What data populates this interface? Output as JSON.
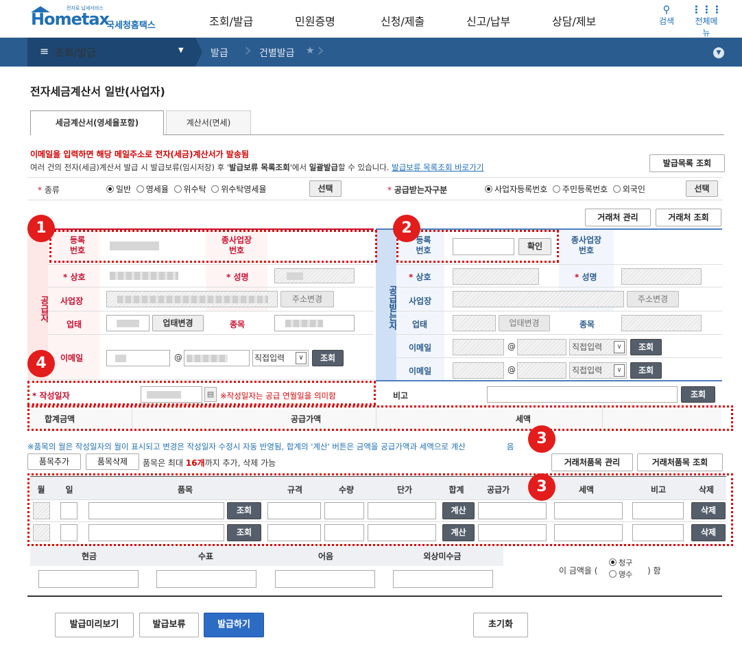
{
  "header": {
    "logo_small": "전자로 납세서비스",
    "logo_main": "Hometax",
    "logo_sub": "국세청홈택스",
    "menu": [
      "조회/발급",
      "민원증명",
      "신청/제출",
      "신고/납부",
      "상담/제보"
    ],
    "search_label": "검색",
    "allmenu_label": "전체메뉴"
  },
  "nav": {
    "home_label": "조회/발급",
    "crumbs": [
      "발급",
      "건별발급"
    ]
  },
  "page": {
    "title": "전자세금계산서 일반(사업자)",
    "tabs": [
      "세금계산서(영세율포함)",
      "계산서(면세)"
    ],
    "notice_red": "이메일을 입력하면 해당 메일주소로 전자(세금)계산서가 발송됨",
    "notice_a": "여러 건의 전자(세금)계산서 발급 시 발급보류(임시저장) 후 '",
    "notice_b": "발급보류 목록조회",
    "notice_c": "'에서 ",
    "notice_d": "일괄발급",
    "notice_e": "할 수 있습니다. ",
    "notice_link": "발급보류 목록조회 바로가기",
    "list_btn": "발급목록 조회"
  },
  "type_row": {
    "label": "종류",
    "options": [
      "일반",
      "영세율",
      "위수탁",
      "위수탁영세율"
    ],
    "select_btn": "선택",
    "recv_label": "공급받는자구분",
    "recv_options": [
      "사업자등록번호",
      "주민등록번호",
      "외국인"
    ],
    "recv_select_btn": "선택"
  },
  "partner_btns": [
    "거래처 관리",
    "거래처 조회"
  ],
  "supplier": {
    "band": "공급자",
    "reg_label": "등록\n번호",
    "sub_label": "종사업장\n번호",
    "name_label": "상호",
    "ceo_label": "성명",
    "addr_label": "사업장",
    "addr_btn": "주소변경",
    "biz_label": "업태",
    "biz_btn": "업태변경",
    "item_label": "종목",
    "email_label": "이메일",
    "email_at": "@",
    "email_select": "직접입력",
    "email_btn": "조회"
  },
  "receiver": {
    "band": "공급받는자",
    "reg_label": "등록\n번호",
    "confirm_btn": "확인",
    "sub_label": "종사업장\n번호",
    "name_label": "상호",
    "ceo_label": "성명",
    "addr_label": "사업장",
    "addr_btn": "주소변경",
    "biz_label": "업태",
    "biz_btn": "업태변경",
    "item_label": "종목",
    "email_label": "이메일",
    "email_at": "@",
    "email_select": "직접입력",
    "email_btn": "조회"
  },
  "date_row": {
    "label": "작성일자",
    "note": "※작성일자는 공급 연월일을 의미함",
    "remark_label": "비고",
    "remark_btn": "조회"
  },
  "totals": {
    "total_label": "합계금액",
    "supply_label": "공급가액",
    "tax_label": "세액"
  },
  "items": {
    "note": "※품목의 월은 작성일자의 월이 표시되고 변경은 작성일자 수정시 자동 반영됨, 합계의 '계산' 버튼은 금액을 공급가액과 세액으로 계산",
    "note_tail": "음",
    "add_btn": "품목추가",
    "del_btn": "품목삭제",
    "limit_a": "품목은 최대 ",
    "limit_b": "16개",
    "limit_c": "까지 추가, 삭제 가능",
    "mgmt_btn": "거래처품목 관리",
    "search_btn": "거래처품목 조회",
    "headers": [
      "월",
      "일",
      "품목",
      "규격",
      "수량",
      "단가",
      "합계",
      "공급가",
      "세액",
      "비고",
      "삭제"
    ],
    "row_search_btn": "조회",
    "row_calc_btn": "계산",
    "row_del_btn": "삭제"
  },
  "payment": {
    "headers": [
      "현금",
      "수표",
      "어음",
      "외상미수금"
    ],
    "amount_prefix": "이 금액을 (",
    "opt1": "청구",
    "opt2": "영수",
    "suffix": ") 함"
  },
  "footer_btns": {
    "preview": "발급미리보기",
    "hold": "발급보류",
    "issue": "발급하기",
    "reset": "초기화"
  },
  "badges": [
    "1",
    "2",
    "3",
    "3",
    "4"
  ]
}
